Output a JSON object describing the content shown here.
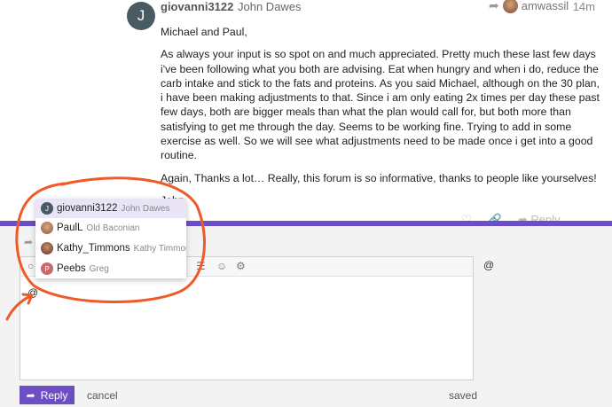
{
  "post": {
    "avatar_letter": "J",
    "username": "giovanni3122",
    "fullname": "John Dawes",
    "reply_to_user": "amwassil",
    "time": "14m",
    "paragraphs": [
      "Michael and Paul,",
      "As always your input is so spot on and much appreciated. Pretty much these last few days i've been following what you both are advising. Eat when hungry and when i do, reduce the carb intake and stick to the fats and proteins. As you said Michael, although on the 30 plan, i have been making adjustments to that. Since i am only eating 2x times per day these past few days, both are bigger meals than what the plan would call for, but both more than satisfying to get me through the day. Seems to be working fine. Trying to add in some exercise as well. So we will see what adjustments need to be made once i get into a good routine.",
      "Again, Thanks a lot… Really, this forum is so informative, thanks to people like yourselves!",
      "John"
    ],
    "actions_reply": "Reply"
  },
  "autocomplete": [
    {
      "avatar": "J",
      "username": "giovanni3122",
      "name": "John Dawes",
      "color": "#4a5a63"
    },
    {
      "avatar": "",
      "username": "PaulL",
      "name": "Old Baconian",
      "color": "#b07a5a"
    },
    {
      "avatar": "",
      "username": "Kathy_Timmons",
      "name": "Kathy Timmons",
      "color": "#8a5a45"
    },
    {
      "avatar": "P",
      "username": "Peebs",
      "name": "Greg",
      "color": "#c96a6a"
    }
  ],
  "editor": {
    "text": "@",
    "preview": "@"
  },
  "footer": {
    "reply_label": "Reply",
    "cancel_label": "cancel",
    "saved_label": "saved"
  },
  "colors": {
    "accent": "#6c4fc4",
    "annotation": "#f05a28"
  }
}
